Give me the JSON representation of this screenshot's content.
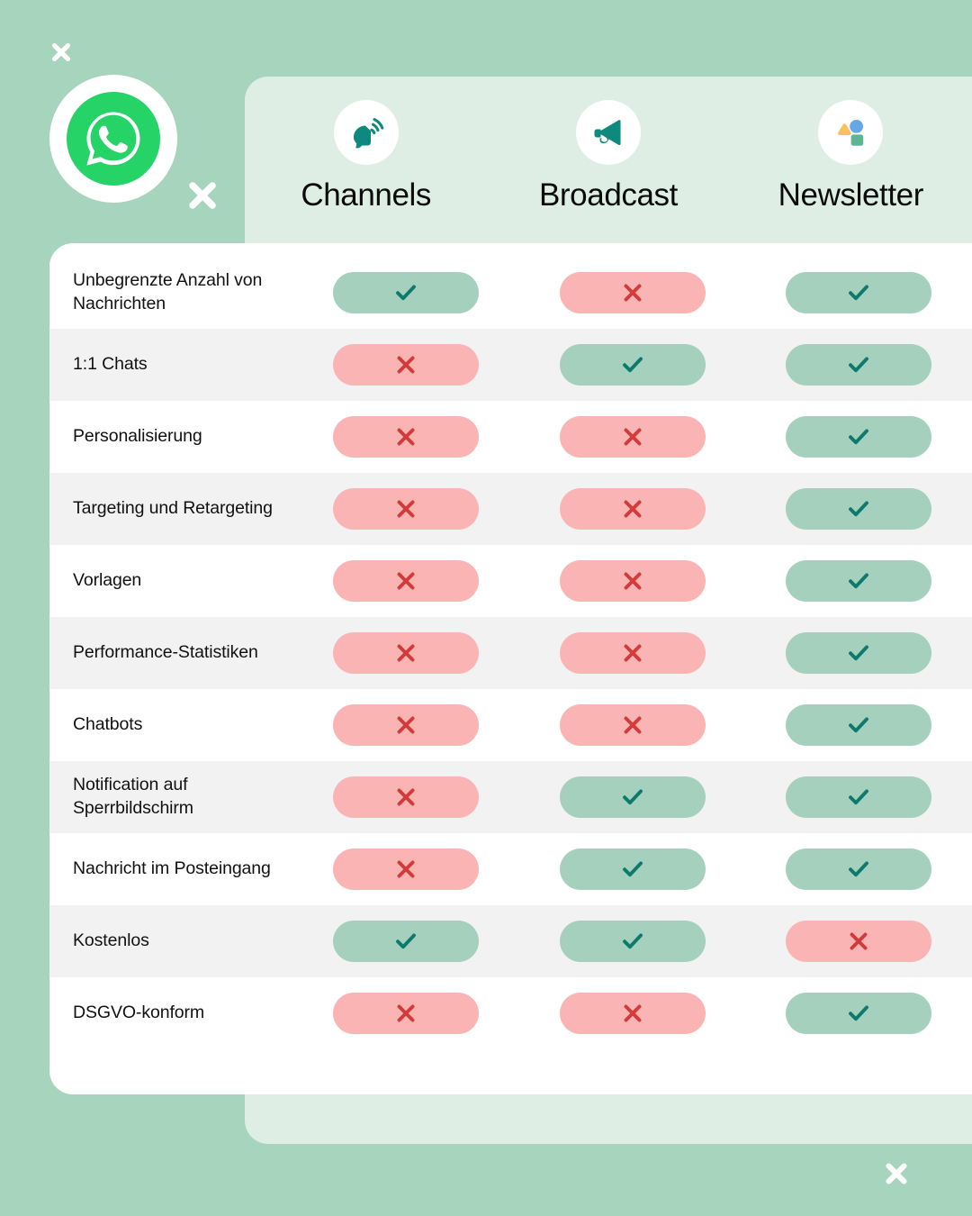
{
  "brand": {
    "logo_icon": "whatsapp-logo-icon",
    "logo_green": "#25D366"
  },
  "decorations": {
    "x_mark_icon": "close-x-icon",
    "x_color": "#ffffff",
    "marks": [
      "top-left",
      "mid-left",
      "bottom-right"
    ]
  },
  "colors": {
    "background": "#a7d4bd",
    "panel": "#dfeee5",
    "card": "#ffffff",
    "row_alt": "#f2f2f2",
    "yes_pill": "#a5d0bd",
    "yes_mark": "#0e7a6e",
    "no_pill": "#fbb4b4",
    "no_mark": "#d13b3b",
    "teal_icon": "#0d8a7d",
    "newsletter_triangle": "#f9c15e",
    "newsletter_circle": "#64a8e8",
    "newsletter_square": "#5eb595",
    "header_text": "#0b0b0b",
    "row_text": "#111111"
  },
  "columns": [
    {
      "label": "Channels",
      "icon": "channels-speaker-icon"
    },
    {
      "label": "Broadcast",
      "icon": "broadcast-megaphone-icon"
    },
    {
      "label": "Newsletter",
      "icon": "newsletter-shapes-icon"
    }
  ],
  "rows": [
    {
      "label": "Unbegrenzte Anzahl von Nachrichten",
      "values": [
        "yes",
        "no",
        "yes"
      ]
    },
    {
      "label": "1:1 Chats",
      "values": [
        "no",
        "yes",
        "yes"
      ]
    },
    {
      "label": "Personalisierung",
      "values": [
        "no",
        "no",
        "yes"
      ]
    },
    {
      "label": "Targeting und Retargeting",
      "values": [
        "no",
        "no",
        "yes"
      ]
    },
    {
      "label": "Vorlagen",
      "values": [
        "no",
        "no",
        "yes"
      ]
    },
    {
      "label": "Performance-Statistiken",
      "values": [
        "no",
        "no",
        "yes"
      ]
    },
    {
      "label": "Chatbots",
      "values": [
        "no",
        "no",
        "yes"
      ]
    },
    {
      "label": "Notification auf Sperrbildschirm",
      "values": [
        "no",
        "yes",
        "yes"
      ]
    },
    {
      "label": "Nachricht im Posteingang",
      "values": [
        "no",
        "yes",
        "yes"
      ]
    },
    {
      "label": "Kostenlos",
      "values": [
        "yes",
        "yes",
        "no"
      ]
    },
    {
      "label": "DSGVO-konform",
      "values": [
        "no",
        "no",
        "yes"
      ]
    }
  ]
}
